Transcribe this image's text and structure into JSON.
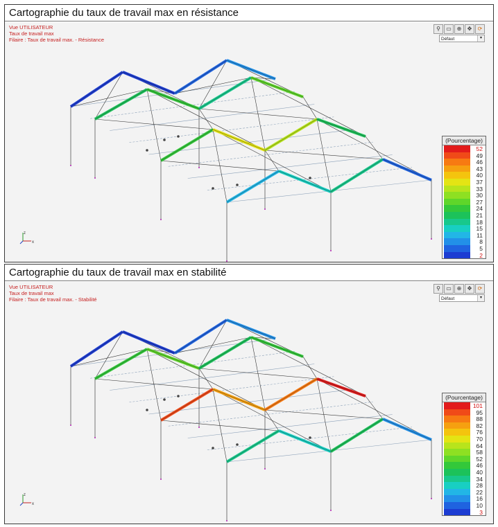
{
  "panels": [
    {
      "title": "Cartographie du taux de travail max en résistance",
      "info": [
        "Vue UTILISATEUR",
        "Taux de travail max",
        "Filaire : Taux de travail max. - Résistance"
      ],
      "dropdown": "Défaut",
      "legend": {
        "title": "(Pourcentage)",
        "values": [
          "52",
          "49",
          "46",
          "43",
          "40",
          "37",
          "33",
          "30",
          "27",
          "24",
          "21",
          "18",
          "15",
          "11",
          "8",
          "5",
          "2"
        ],
        "colors": [
          "#e21b1b",
          "#f04a18",
          "#f77a12",
          "#f6a010",
          "#f4c40e",
          "#e4e414",
          "#b8e41c",
          "#8ee022",
          "#5fd62a",
          "#33c83a",
          "#1cc25a",
          "#18c88c",
          "#18cfc2",
          "#22b6e6",
          "#2290e8",
          "#1f63e0",
          "#1c3cd2"
        ]
      }
    },
    {
      "title": "Cartographie du taux de travail max en stabilité",
      "info": [
        "Vue UTILISATEUR",
        "Taux de travail max",
        "Filaire : Taux de travail max. - Stabilité"
      ],
      "dropdown": "Défaut",
      "legend": {
        "title": "(Pourcentage)",
        "values": [
          "101",
          "95",
          "88",
          "82",
          "76",
          "70",
          "64",
          "58",
          "52",
          "46",
          "40",
          "34",
          "28",
          "22",
          "16",
          "10",
          "3"
        ],
        "colors": [
          "#e21b1b",
          "#f04a18",
          "#f77a12",
          "#f6a010",
          "#f4c40e",
          "#e4e414",
          "#b8e41c",
          "#8ee022",
          "#5fd62a",
          "#33c83a",
          "#1cc25a",
          "#18c88c",
          "#18cfc2",
          "#22b6e6",
          "#2290e8",
          "#1f63e0",
          "#1c3cd2"
        ]
      }
    }
  ],
  "toolbar_icons": [
    "zoom-out-icon",
    "zoom-window-icon",
    "zoom-in-icon",
    "pan-icon",
    "rotate-icon"
  ],
  "axes": {
    "x": "x",
    "z": "z"
  }
}
